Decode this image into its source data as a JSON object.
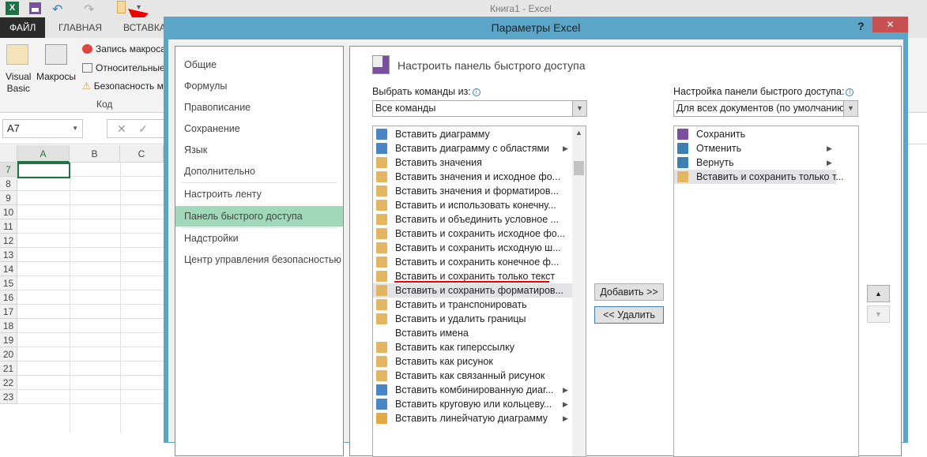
{
  "window": {
    "title": "Книга1 - Excel"
  },
  "qat": {
    "excel": "X",
    "more": "▾"
  },
  "ribbon": {
    "tabs": [
      "ФАЙЛ",
      "ГЛАВНАЯ",
      "ВСТАВКА"
    ],
    "vb_line1": "Visual",
    "vb_line2": "Basic",
    "macros": "Макросы",
    "record": "Запись макроса",
    "relative": "Относительные ссылки",
    "security": "Безопасность макросов",
    "group": "Код"
  },
  "formula_bar": {
    "name_box": "A7",
    "cancel": "✕",
    "enter": "✓"
  },
  "sheet": {
    "columns": [
      "A",
      "B",
      "C"
    ],
    "rows": [
      "7",
      "8",
      "9",
      "10",
      "11",
      "12",
      "13",
      "14",
      "15",
      "16",
      "17",
      "18",
      "19",
      "20",
      "21",
      "22",
      "23"
    ]
  },
  "dialog": {
    "title": "Параметры Excel",
    "help": "?",
    "close": "✕",
    "nav": [
      "Общие",
      "Формулы",
      "Правописание",
      "Сохранение",
      "Язык",
      "Дополнительно",
      "Настроить ленту",
      "Панель быстрого доступа",
      "Надстройки",
      "Центр управления безопасностью"
    ],
    "heading": "Настроить панель быстрого доступа",
    "choose_label": "Выбрать команды из:",
    "choose_value": "Все команды",
    "customize_label": "Настройка панели быстрого доступа:",
    "customize_value": "Для всех документов (по умолчанию)",
    "commands": [
      {
        "label": "Вставить диаграмму",
        "color": "#4a86c5",
        "sub": false
      },
      {
        "label": "Вставить диаграмму с областями",
        "color": "#4a86c5",
        "sub": true
      },
      {
        "label": "Вставить значения",
        "color": "#e4b661",
        "sub": false
      },
      {
        "label": "Вставить значения и исходное фо...",
        "color": "#e4b661",
        "sub": false
      },
      {
        "label": "Вставить значения и форматиров...",
        "color": "#e4b661",
        "sub": false
      },
      {
        "label": "Вставить и использовать конечну...",
        "color": "#e4b661",
        "sub": false
      },
      {
        "label": "Вставить и объединить условное ...",
        "color": "#e4b661",
        "sub": false
      },
      {
        "label": "Вставить и сохранить исходное фо...",
        "color": "#e4b661",
        "sub": false
      },
      {
        "label": "Вставить и сохранить исходную ш...",
        "color": "#e4b661",
        "sub": false
      },
      {
        "label": "Вставить и сохранить конечное ф...",
        "color": "#e4b661",
        "sub": false
      },
      {
        "label": "Вставить и сохранить только текст",
        "color": "#e4b661",
        "sub": false
      },
      {
        "label": "Вставить и сохранить форматиров...",
        "color": "#e4b661",
        "sub": false
      },
      {
        "label": "Вставить и транспонировать",
        "color": "#e4b661",
        "sub": false
      },
      {
        "label": "Вставить и удалить границы",
        "color": "#e4b661",
        "sub": false
      },
      {
        "label": "Вставить имена",
        "color": "",
        "sub": false
      },
      {
        "label": "Вставить как гиперссылку",
        "color": "#e4b661",
        "sub": false
      },
      {
        "label": "Вставить как рисунок",
        "color": "#e4b661",
        "sub": false
      },
      {
        "label": "Вставить как связанный рисунок",
        "color": "#e4b661",
        "sub": false
      },
      {
        "label": "Вставить комбинированную диаг...",
        "color": "#4a86c5",
        "sub": true
      },
      {
        "label": "Вставить круговую или кольцеву...",
        "color": "#4a86c5",
        "sub": true
      },
      {
        "label": "Вставить линейчатую диаграмму",
        "color": "#e4a840",
        "sub": true
      }
    ],
    "qat_items": [
      {
        "label": "Сохранить",
        "color": "#7b4fa0",
        "sub": false
      },
      {
        "label": "Отменить",
        "color": "#3c7fb1",
        "sub": true
      },
      {
        "label": "Вернуть",
        "color": "#3c7fb1",
        "sub": true
      },
      {
        "label": "Вставить и сохранить только т...",
        "color": "#e4b661",
        "sub": false
      }
    ],
    "add": "Добавить >>",
    "remove": "<< Удалить",
    "up": "▲",
    "down": "▼"
  }
}
